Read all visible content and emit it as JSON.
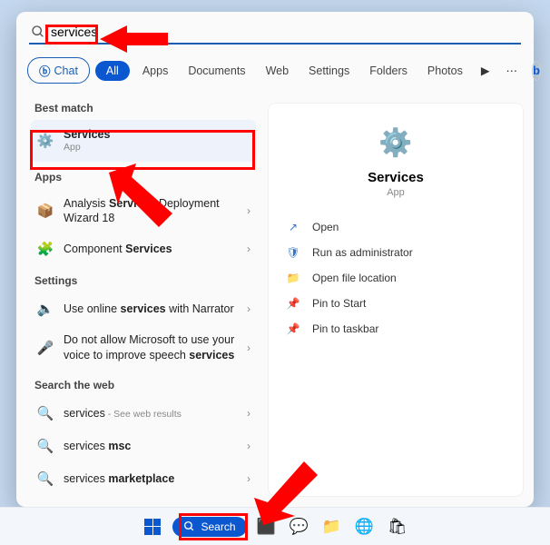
{
  "search": {
    "value": "services"
  },
  "filters": {
    "chat": "Chat",
    "all": "All",
    "apps": "Apps",
    "documents": "Documents",
    "web": "Web",
    "settings": "Settings",
    "folders": "Folders",
    "photos": "Photos"
  },
  "sections": {
    "best_match": "Best match",
    "apps": "Apps",
    "settings": "Settings",
    "web": "Search the web"
  },
  "results": {
    "best": {
      "title": "Services",
      "sub": "App"
    },
    "app1": {
      "title": "Analysis Services Deployment Wizard 18"
    },
    "app2": {
      "title": "Component Services"
    },
    "set1": {
      "title": "Use online services with Narrator"
    },
    "set2": {
      "title": "Do not allow Microsoft to use your voice to improve speech services"
    },
    "web1": {
      "title": "services",
      "sub": " - See web results"
    },
    "web2": {
      "title": "services msc"
    },
    "web3": {
      "title": "services marketplace"
    }
  },
  "detail": {
    "title": "Services",
    "sub": "App",
    "actions": {
      "open": "Open",
      "admin": "Run as administrator",
      "location": "Open file location",
      "pin_start": "Pin to Start",
      "pin_taskbar": "Pin to taskbar"
    }
  },
  "taskbar": {
    "search": "Search"
  }
}
